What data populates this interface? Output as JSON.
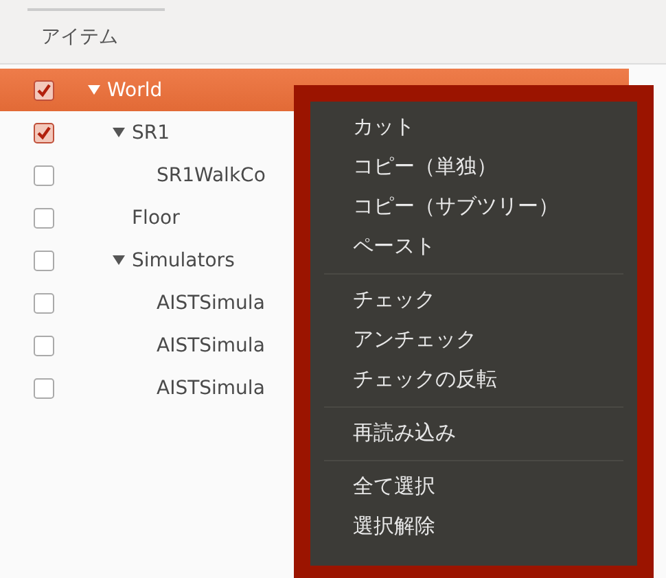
{
  "header": {
    "title": "アイテム"
  },
  "tree": [
    {
      "label": "World",
      "checked": true,
      "selected": true,
      "expanded": true,
      "children": [
        {
          "label": "SR1",
          "checked": true,
          "selected": false,
          "expanded": true,
          "children": [
            {
              "label": "SR1WalkCo",
              "checked": false,
              "selected": false
            }
          ]
        },
        {
          "label": "Floor",
          "checked": false,
          "selected": false
        },
        {
          "label": "Simulators",
          "checked": false,
          "selected": false,
          "expanded": true,
          "children": [
            {
              "label": "AISTSimula",
              "checked": false,
              "selected": false
            },
            {
              "label": "AISTSimula",
              "checked": false,
              "selected": false
            },
            {
              "label": "AISTSimula",
              "checked": false,
              "selected": false
            }
          ]
        }
      ]
    }
  ],
  "context_menu": {
    "items": [
      {
        "kind": "item",
        "label": "カット"
      },
      {
        "kind": "item",
        "label": "コピー（単独）"
      },
      {
        "kind": "item",
        "label": "コピー（サブツリー）"
      },
      {
        "kind": "item",
        "label": "ペースト"
      },
      {
        "kind": "separator"
      },
      {
        "kind": "item",
        "label": "チェック"
      },
      {
        "kind": "item",
        "label": "アンチェック"
      },
      {
        "kind": "item",
        "label": "チェックの反転"
      },
      {
        "kind": "separator"
      },
      {
        "kind": "item",
        "label": "再読み込み"
      },
      {
        "kind": "separator"
      },
      {
        "kind": "item",
        "label": "全て選択"
      },
      {
        "kind": "item",
        "label": "選択解除"
      }
    ]
  }
}
